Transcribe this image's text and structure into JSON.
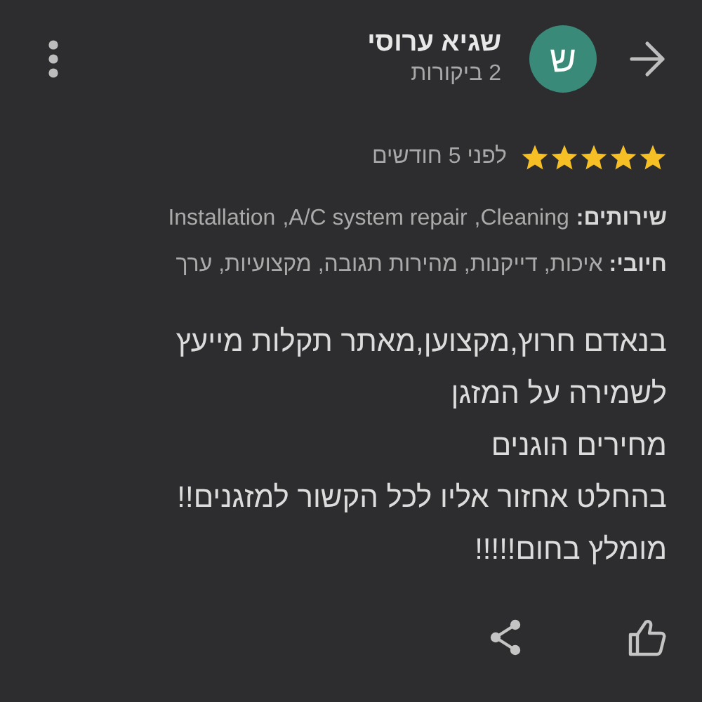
{
  "reviewer": {
    "name": "שגיא ערוסי",
    "reviews": "2 ביקורות",
    "avatar_letter": "ש"
  },
  "rating": {
    "stars": 5,
    "time": "לפני 5 חודשים"
  },
  "services": {
    "label": "שירותים:",
    "items": [
      "Cleaning,",
      "A/C system repair,",
      "Installation"
    ]
  },
  "pros": "**חיובי:** איכות, דייקנות, מהירות תגובה, מקצועיות, ערך",
  "body_lines": [
    "בנאדם חרוץ,מקצוען,מאתר תקלות מייעץ",
    "לשמירה על המזגן",
    "מחירים הוגנים",
    "בהחלט אחזור אליו לכל הקשור למזגנים!!",
    "מומלץ בחום!!!!!"
  ]
}
